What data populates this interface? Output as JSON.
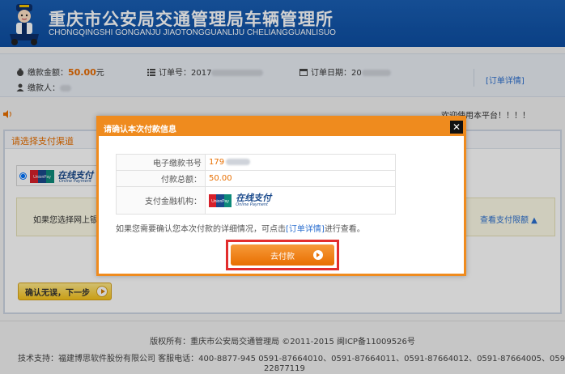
{
  "header": {
    "title": "重庆市公安局交通管理局车辆管理所",
    "subtitle": "CHONGQINGSHI GONGANJU JIAOTONGGUANLIJU CHELIANGGUANLISUO",
    "logo_icon": "police-mascot-logo"
  },
  "order": {
    "amount_label": "缴款金额：",
    "amount_value": "50.00",
    "amount_unit": "元",
    "payer_label": "缴款人：",
    "order_no_label": "订单号：",
    "order_no_value": "2017",
    "order_date_label": "订单日期：",
    "order_date_value": "20",
    "detail_link": "[订单详情]"
  },
  "notice_line": "欢迎使用本平台！！！！",
  "panel": {
    "title": "请选择支付渠道",
    "notice_text": "如果您选择网上银行",
    "limit_link": "查看支付限额 ▲",
    "next_button": "确认无误，下一步"
  },
  "unionpay": {
    "brand": "UnionPay",
    "brand_cn": "银联",
    "label": "在线支付",
    "label_en": "Online Payment"
  },
  "modal": {
    "title": "请确认本次付款信息",
    "close": "✕",
    "rows": [
      {
        "label": "电子缴款书号",
        "value": "179"
      },
      {
        "label": "付款总额：",
        "value": "50.00"
      },
      {
        "label": "支付金融机构："
      }
    ],
    "note_prefix": "如果您需要确认您本次付款的详细情况，可点击",
    "note_link": "[订单详情]",
    "note_suffix": "进行查看。",
    "pay_button": "去付款"
  },
  "footer": {
    "copyright": "版权所有：重庆市公安局交通管理局 ©2011-2015 闽ICP备11009526号",
    "support": "技术支持：福建博思软件股份有限公司   客服电话：400-8877-945 0591-87664010、0591-87664011、0591-87664012、0591-87664005、0591-",
    "support_cont": "22877119"
  },
  "colors": {
    "header_blue": "#1a5fb4",
    "accent_orange": "#ef8b1e",
    "link_blue": "#2a6ecf",
    "highlight_red": "#e22d2d"
  }
}
